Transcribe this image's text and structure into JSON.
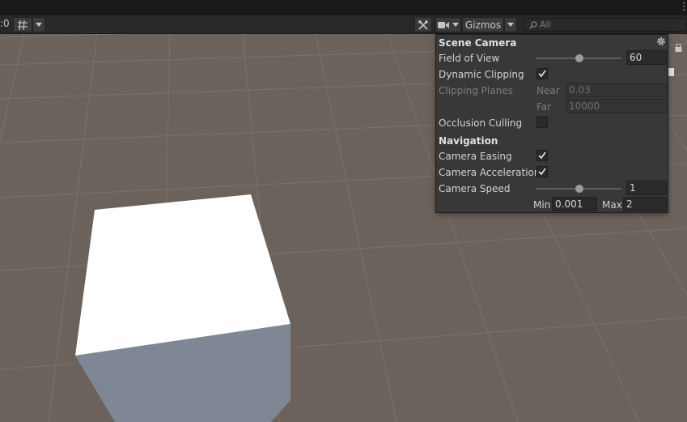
{
  "toolbar": {
    "left_fragment": ":0",
    "gizmos_label": "Gizmos",
    "search_placeholder": "All"
  },
  "popup": {
    "title": "Scene Camera",
    "field_of_view_label": "Field of View",
    "field_of_view_value": "60",
    "field_of_view_slider": 0.5,
    "dynamic_clipping_label": "Dynamic Clipping",
    "dynamic_clipping_checked": true,
    "clipping_planes_label": "Clipping Planes",
    "near_label": "Near",
    "near_value": "0.03",
    "far_label": "Far",
    "far_value": "10000",
    "occlusion_culling_label": "Occlusion Culling",
    "occlusion_culling_checked": false,
    "navigation_title": "Navigation",
    "camera_easing_label": "Camera Easing",
    "camera_easing_checked": true,
    "camera_acceleration_label": "Camera Acceleration",
    "camera_acceleration_checked": true,
    "camera_speed_label": "Camera Speed",
    "camera_speed_value": "1",
    "camera_speed_slider": 0.5,
    "min_label": "Min",
    "min_value": "0.001",
    "max_label": "Max",
    "max_value": "2"
  },
  "icons": [
    "kebab-menu-icon",
    "grid-icon",
    "tools-icon",
    "camera-icon",
    "search-icon",
    "gear-icon",
    "lock-icon",
    "checkmark-icon"
  ]
}
